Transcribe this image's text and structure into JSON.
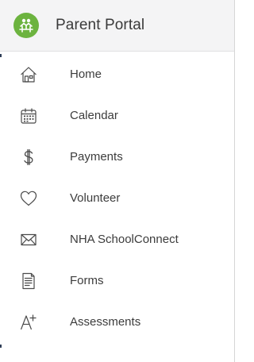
{
  "app": {
    "title": "Parent Portal",
    "logo_icon": "school-children-icon",
    "brand_color": "#6cb33f"
  },
  "menu": {
    "items": [
      {
        "label": "Home",
        "icon": "home-icon"
      },
      {
        "label": "Calendar",
        "icon": "calendar-icon"
      },
      {
        "label": "Payments",
        "icon": "dollar-icon"
      },
      {
        "label": "Volunteer",
        "icon": "heart-icon"
      },
      {
        "label": "NHA SchoolConnect",
        "icon": "envelope-icon"
      },
      {
        "label": "Forms",
        "icon": "document-icon"
      },
      {
        "label": "Assessments",
        "icon": "assessment-icon"
      }
    ]
  }
}
